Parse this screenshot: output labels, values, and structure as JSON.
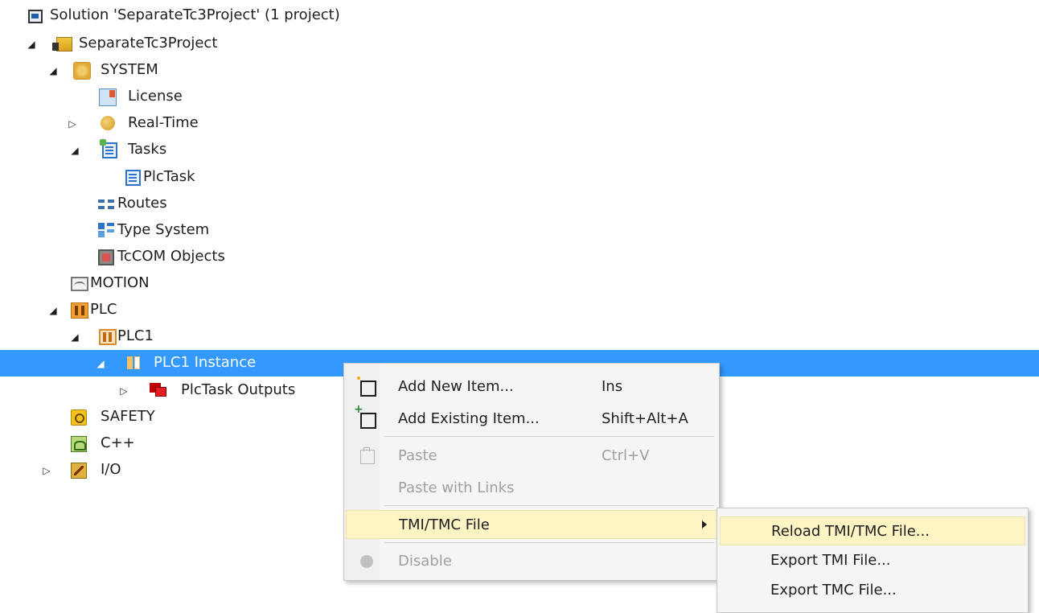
{
  "tree": {
    "solution_label": "Solution 'SeparateTc3Project' (1 project)",
    "project_label": "SeparateTc3Project",
    "system_label": "SYSTEM",
    "license_label": "License",
    "realtime_label": "Real-Time",
    "tasks_label": "Tasks",
    "plctask_label": "PlcTask",
    "routes_label": "Routes",
    "typesystem_label": "Type System",
    "tccom_label": "TcCOM Objects",
    "motion_label": "MOTION",
    "plc_label": "PLC",
    "plc1_label": "PLC1",
    "instance_label": "PLC1 Instance",
    "outputs_label": "PlcTask Outputs",
    "safety_label": "SAFETY",
    "cpp_label": "C++",
    "io_label": "I/O",
    "selected_item": "PLC1 Instance"
  },
  "context_menu": {
    "items": [
      {
        "label": "Add New Item...",
        "shortcut": "Ins",
        "icon": "add-new-item-icon",
        "enabled": true
      },
      {
        "label": "Add Existing Item...",
        "shortcut": "Shift+Alt+A",
        "icon": "add-existing-item-icon",
        "enabled": true
      },
      {
        "label": "Paste",
        "shortcut": "Ctrl+V",
        "icon": "paste-icon",
        "enabled": false
      },
      {
        "label": "Paste with Links",
        "shortcut": "",
        "icon": "",
        "enabled": false
      },
      {
        "label": "TMI/TMC File",
        "shortcut": "",
        "icon": "",
        "enabled": true,
        "has_submenu": true
      },
      {
        "label": "Disable",
        "shortcut": "",
        "icon": "disable-icon",
        "enabled": false
      }
    ]
  },
  "submenu": {
    "items": [
      {
        "label": "Reload TMI/TMC File..."
      },
      {
        "label": "Export TMI File..."
      },
      {
        "label": "Export TMC File..."
      }
    ]
  },
  "colors": {
    "selection": "#3399ff",
    "menu_highlight": "#fff4c4"
  }
}
